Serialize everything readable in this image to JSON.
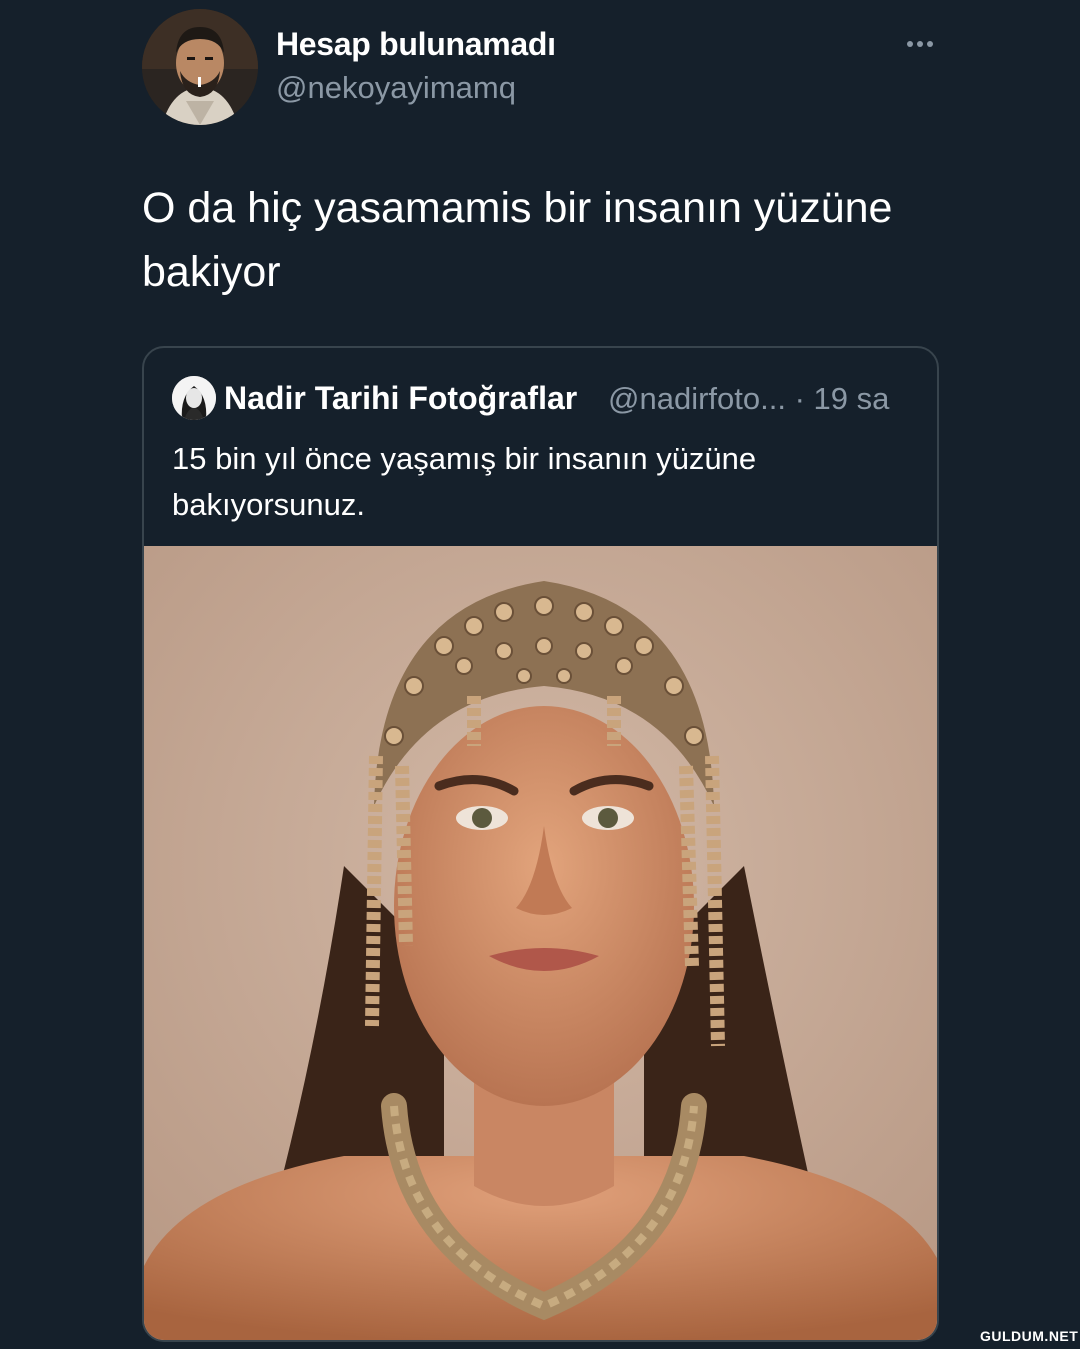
{
  "tweet": {
    "author_name": "Hesap bulunamadı",
    "author_handle": "@nekoyayimamq",
    "text": "O da hiç yasamamis bir insanın yüzüne bakiyor"
  },
  "quoted_tweet": {
    "author_name": "Nadir Tarihi Fotoğraflar",
    "author_handle": "@nadirfoto...",
    "time": "· 19 sa",
    "text": "15 bin yıl önce yaşamış bir insanın yüzüne bakıyorsunuz."
  },
  "icons": {
    "more": "more-horizontal-icon"
  },
  "colors": {
    "background": "#15202b",
    "secondary_text": "#8b98a5",
    "border": "#38444d"
  },
  "watermark": "GULDUM.NET"
}
